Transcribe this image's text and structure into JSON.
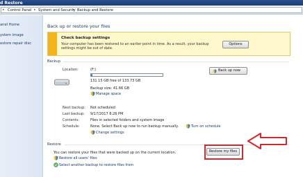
{
  "window": {
    "title": "d Restore"
  },
  "breadcrumb": {
    "items": [
      "Control Panel",
      "System and Security",
      "Backup and Restore"
    ]
  },
  "sidebar": {
    "items": [
      {
        "label": "anel Home"
      },
      {
        "label": "ystem image"
      },
      {
        "label": "estore repair disc"
      }
    ]
  },
  "main": {
    "title": "Back up or restore your files",
    "notice": {
      "title": "Check backup settings",
      "body": "Your computer has been restored to an earlier point in time. As a result, your backup settings might be out of date.",
      "button": "Options",
      "accent_color": "#f3b31a"
    },
    "backup": {
      "section_title": "Backup",
      "location_label": "Location:",
      "location_value": "(F:)",
      "usage_text": "131.15 GB free of 133.73 GB",
      "used_fraction": 0.019,
      "backup_size_text": "Backup size: 41.66 GB",
      "manage_space_link": "Manage space",
      "back_up_now_button": "Back up now",
      "next_backup_label": "Next backup:",
      "next_backup_value": "Not scheduled",
      "last_backup_label": "Last backup:",
      "last_backup_value": "9/17/2017 8:26 PM",
      "contents_label": "Contents:",
      "contents_value": "Files in selected folders and system image",
      "schedule_label": "Schedule:",
      "schedule_value": "None. Select Back up now to run backup manually.",
      "turn_on_schedule_link": "Turn on schedule",
      "change_settings_link": "Change settings"
    },
    "restore": {
      "section_title": "Restore",
      "description": "You can restore your files that were backed up on the current location.",
      "restore_files_button": "Restore my files",
      "restore_all_users_link": "Restore all users' files",
      "select_another_link": "Select another backup to restore files from",
      "highlight_color": "#d9262c"
    }
  }
}
